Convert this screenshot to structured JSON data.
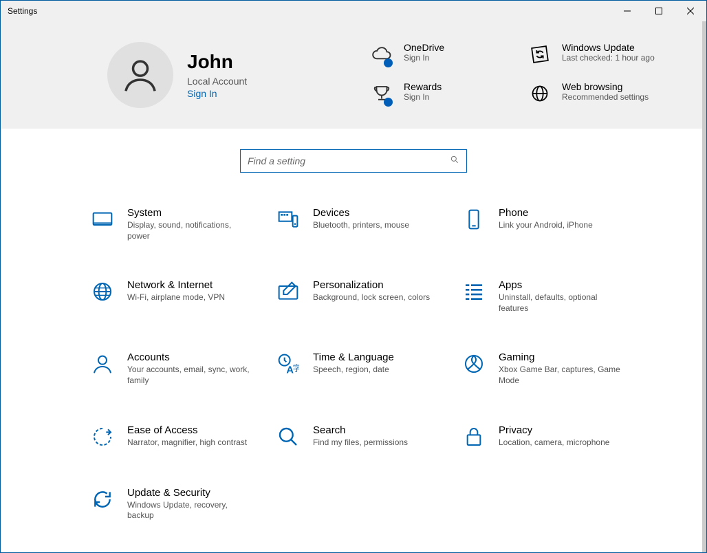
{
  "window": {
    "title": "Settings"
  },
  "user": {
    "name": "John",
    "type": "Local Account",
    "signin": "Sign In"
  },
  "status": [
    {
      "id": "onedrive",
      "title": "OneDrive",
      "sub": "Sign In"
    },
    {
      "id": "windows-update",
      "title": "Windows Update",
      "sub": "Last checked: 1 hour ago"
    },
    {
      "id": "rewards",
      "title": "Rewards",
      "sub": "Sign In"
    },
    {
      "id": "web-browsing",
      "title": "Web browsing",
      "sub": "Recommended settings"
    }
  ],
  "search": {
    "placeholder": "Find a setting"
  },
  "categories": [
    {
      "id": "system",
      "title": "System",
      "sub": "Display, sound, notifications, power"
    },
    {
      "id": "devices",
      "title": "Devices",
      "sub": "Bluetooth, printers, mouse"
    },
    {
      "id": "phone",
      "title": "Phone",
      "sub": "Link your Android, iPhone"
    },
    {
      "id": "network",
      "title": "Network & Internet",
      "sub": "Wi-Fi, airplane mode, VPN"
    },
    {
      "id": "personalization",
      "title": "Personalization",
      "sub": "Background, lock screen, colors"
    },
    {
      "id": "apps",
      "title": "Apps",
      "sub": "Uninstall, defaults, optional features"
    },
    {
      "id": "accounts",
      "title": "Accounts",
      "sub": "Your accounts, email, sync, work, family"
    },
    {
      "id": "time-language",
      "title": "Time & Language",
      "sub": "Speech, region, date"
    },
    {
      "id": "gaming",
      "title": "Gaming",
      "sub": "Xbox Game Bar, captures, Game Mode"
    },
    {
      "id": "ease-of-access",
      "title": "Ease of Access",
      "sub": "Narrator, magnifier, high contrast"
    },
    {
      "id": "search",
      "title": "Search",
      "sub": "Find my files, permissions"
    },
    {
      "id": "privacy",
      "title": "Privacy",
      "sub": "Location, camera, microphone"
    },
    {
      "id": "update-security",
      "title": "Update & Security",
      "sub": "Windows Update, recovery, backup"
    }
  ]
}
